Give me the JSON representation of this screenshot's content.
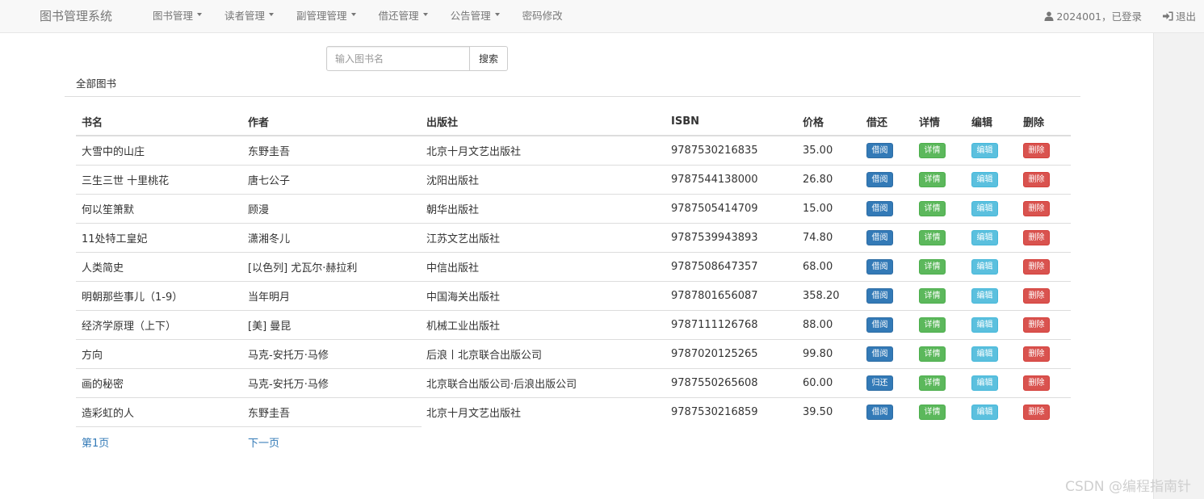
{
  "navbar": {
    "brand": "图书管理系统",
    "menu": [
      {
        "label": "图书管理",
        "has_dropdown": true
      },
      {
        "label": "读者管理",
        "has_dropdown": true
      },
      {
        "label": "副管理管理",
        "has_dropdown": true
      },
      {
        "label": "借还管理",
        "has_dropdown": true
      },
      {
        "label": "公告管理",
        "has_dropdown": true
      },
      {
        "label": "密码修改",
        "has_dropdown": false
      }
    ],
    "user_text": "2024001，已登录",
    "logout_label": "退出"
  },
  "search": {
    "placeholder": "输入图书名",
    "value": "",
    "button_label": "搜索"
  },
  "panel": {
    "title": "全部图书"
  },
  "table": {
    "headers": [
      "书名",
      "作者",
      "出版社",
      "ISBN",
      "价格",
      "借还",
      "详情",
      "编辑",
      "删除"
    ],
    "rows": [
      {
        "title": "大雪中的山庄",
        "author": "东野圭吾",
        "publisher": "北京十月文艺出版社",
        "isbn": "9787530216835",
        "price": "35.00",
        "borrow_label": "借阅",
        "detail_label": "详情",
        "edit_label": "编辑",
        "delete_label": "删除"
      },
      {
        "title": "三生三世 十里桃花",
        "author": "唐七公子",
        "publisher": "沈阳出版社",
        "isbn": "9787544138000",
        "price": "26.80",
        "borrow_label": "借阅",
        "detail_label": "详情",
        "edit_label": "编辑",
        "delete_label": "删除"
      },
      {
        "title": "何以笙箫默",
        "author": "顾漫",
        "publisher": "朝华出版社",
        "isbn": "9787505414709",
        "price": "15.00",
        "borrow_label": "借阅",
        "detail_label": "详情",
        "edit_label": "编辑",
        "delete_label": "删除"
      },
      {
        "title": "11处特工皇妃",
        "author": "潇湘冬儿",
        "publisher": "江苏文艺出版社",
        "isbn": "9787539943893",
        "price": "74.80",
        "borrow_label": "借阅",
        "detail_label": "详情",
        "edit_label": "编辑",
        "delete_label": "删除"
      },
      {
        "title": "人类简史",
        "author": "[以色列] 尤瓦尔·赫拉利",
        "publisher": "中信出版社",
        "isbn": "9787508647357",
        "price": "68.00",
        "borrow_label": "借阅",
        "detail_label": "详情",
        "edit_label": "编辑",
        "delete_label": "删除"
      },
      {
        "title": "明朝那些事儿（1-9）",
        "author": "当年明月",
        "publisher": "中国海关出版社",
        "isbn": "9787801656087",
        "price": "358.20",
        "borrow_label": "借阅",
        "detail_label": "详情",
        "edit_label": "编辑",
        "delete_label": "删除"
      },
      {
        "title": "经济学原理（上下）",
        "author": "[美] 曼昆",
        "publisher": "机械工业出版社",
        "isbn": "9787111126768",
        "price": "88.00",
        "borrow_label": "借阅",
        "detail_label": "详情",
        "edit_label": "编辑",
        "delete_label": "删除"
      },
      {
        "title": "方向",
        "author": "马克-安托万·马修",
        "publisher": "后浪丨北京联合出版公司",
        "isbn": "9787020125265",
        "price": "99.80",
        "borrow_label": "借阅",
        "detail_label": "详情",
        "edit_label": "编辑",
        "delete_label": "删除"
      },
      {
        "title": "画的秘密",
        "author": "马克-安托万·马修",
        "publisher": "北京联合出版公司·后浪出版公司",
        "isbn": "9787550265608",
        "price": "60.00",
        "borrow_label": "归还",
        "detail_label": "详情",
        "edit_label": "编辑",
        "delete_label": "删除"
      },
      {
        "title": "造彩虹的人",
        "author": "东野圭吾",
        "publisher": "北京十月文艺出版社",
        "isbn": "9787530216859",
        "price": "39.50",
        "borrow_label": "借阅",
        "detail_label": "详情",
        "edit_label": "编辑",
        "delete_label": "删除"
      }
    ]
  },
  "pager": {
    "first_label": "第1页",
    "next_label": "下一页"
  },
  "watermark": "CSDN @编程指南针",
  "colors": {
    "link": "#337ab7",
    "borrow": "#337ab7",
    "detail": "#5cb85c",
    "edit": "#5bc0de",
    "delete": "#d9534f"
  }
}
